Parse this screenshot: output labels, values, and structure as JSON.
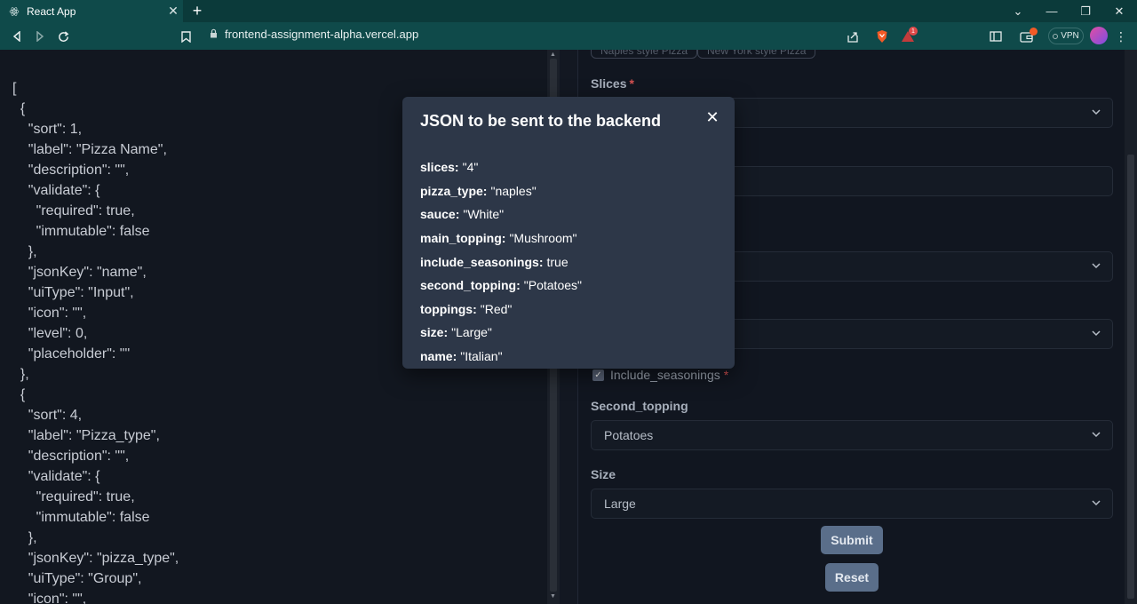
{
  "browser": {
    "tab_title": "React App",
    "tab_close": "✕",
    "new_tab": "+",
    "url": "frontend-assignment-alpha.vercel.app",
    "vpn_label": "VPN",
    "brave_badge_count": "1"
  },
  "left_pane": {
    "json_text": "[\n  {\n    \"sort\": 1,\n    \"label\": \"Pizza Name\",\n    \"description\": \"\",\n    \"validate\": {\n      \"required\": true,\n      \"immutable\": false\n    },\n    \"jsonKey\": \"name\",\n    \"uiType\": \"Input\",\n    \"icon\": \"\",\n    \"level\": 0,\n    \"placeholder\": \"\"\n  },\n  {\n    \"sort\": 4,\n    \"label\": \"Pizza_type\",\n    \"description\": \"\",\n    \"validate\": {\n      \"required\": true,\n      \"immutable\": false\n    },\n    \"jsonKey\": \"pizza_type\",\n    \"uiType\": \"Group\",\n    \"icon\": \"\","
  },
  "form": {
    "pill_1": "Naples style Pizza",
    "pill_2": "New York style Pizza",
    "slices_label": "Slices",
    "required_mark": "*",
    "checkbox_label": "Include_seasonings",
    "second_topping_label": "Second_topping",
    "second_topping_value": "Potatoes",
    "size_label": "Size",
    "size_value": "Large",
    "submit_label": "Submit",
    "reset_label": "Reset"
  },
  "modal": {
    "title": "JSON to be sent to the backend",
    "close_glyph": "✕",
    "entries": [
      {
        "key": "slices:",
        "value": "\"4\""
      },
      {
        "key": "pizza_type:",
        "value": "\"naples\""
      },
      {
        "key": "sauce:",
        "value": "\"White\""
      },
      {
        "key": "main_topping:",
        "value": "\"Mushroom\""
      },
      {
        "key": "include_seasonings:",
        "value": "true"
      },
      {
        "key": "second_topping:",
        "value": "\"Potatoes\""
      },
      {
        "key": "toppings:",
        "value": "\"Red\""
      },
      {
        "key": "size:",
        "value": "\"Large\""
      },
      {
        "key": "name:",
        "value": "\"Italian\""
      }
    ]
  },
  "colors": {
    "chrome": "#0f4a4a",
    "page_bg": "#131822",
    "modal_bg": "#2d3748",
    "required": "#d55151",
    "button": "#5a6e8a"
  }
}
